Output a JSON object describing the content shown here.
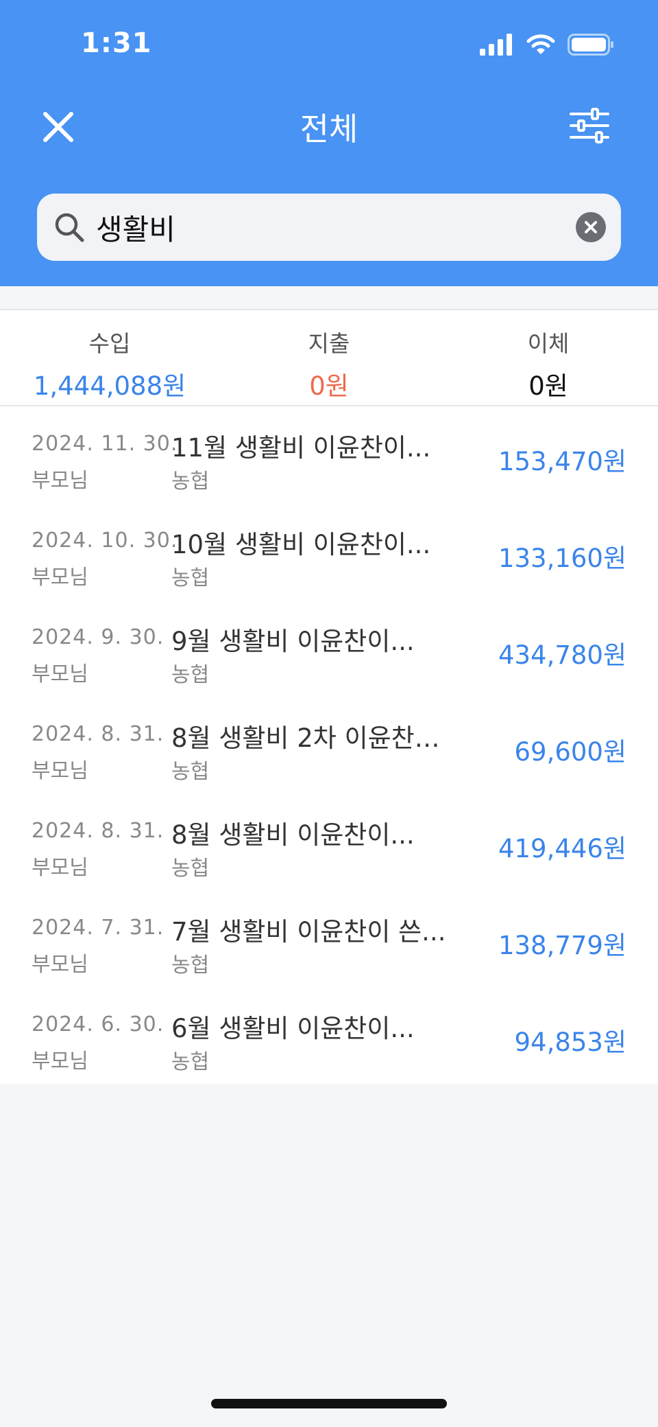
{
  "status_bar": {
    "time": "1:31"
  },
  "header": {
    "title": "전체"
  },
  "search": {
    "value": "생활비",
    "placeholder": ""
  },
  "summary": {
    "income": {
      "label": "수입",
      "value": "1,444,088원"
    },
    "expense": {
      "label": "지출",
      "value": "0원"
    },
    "transfer": {
      "label": "이체",
      "value": "0원"
    }
  },
  "transactions": [
    {
      "date": "2024. 11. 30.",
      "person": "부모님",
      "title": "11월 생활비 이윤찬이...",
      "bank": "농협",
      "amount": "153,470원"
    },
    {
      "date": "2024. 10. 30.",
      "person": "부모님",
      "title": "10월 생활비 이윤찬이...",
      "bank": "농협",
      "amount": "133,160원"
    },
    {
      "date": "2024. 9. 30.",
      "person": "부모님",
      "title": "9월 생활비 이윤찬이...",
      "bank": "농협",
      "amount": "434,780원"
    },
    {
      "date": "2024. 8. 31.",
      "person": "부모님",
      "title": "8월 생활비 2차 이윤찬…",
      "bank": "농협",
      "amount": "69,600원"
    },
    {
      "date": "2024. 8. 31.",
      "person": "부모님",
      "title": "8월 생활비 이윤찬이...",
      "bank": "농협",
      "amount": "419,446원"
    },
    {
      "date": "2024. 7. 31.",
      "person": "부모님",
      "title": "7월 생활비 이윤찬이 쓴...",
      "bank": "농협",
      "amount": "138,779원"
    },
    {
      "date": "2024. 6. 30.",
      "person": "부모님",
      "title": "6월 생활비 이윤찬이...",
      "bank": "농협",
      "amount": "94,853원"
    }
  ],
  "colors": {
    "header": "#4893f3",
    "income": "#3a84ea",
    "expense": "#ee6a4c"
  }
}
